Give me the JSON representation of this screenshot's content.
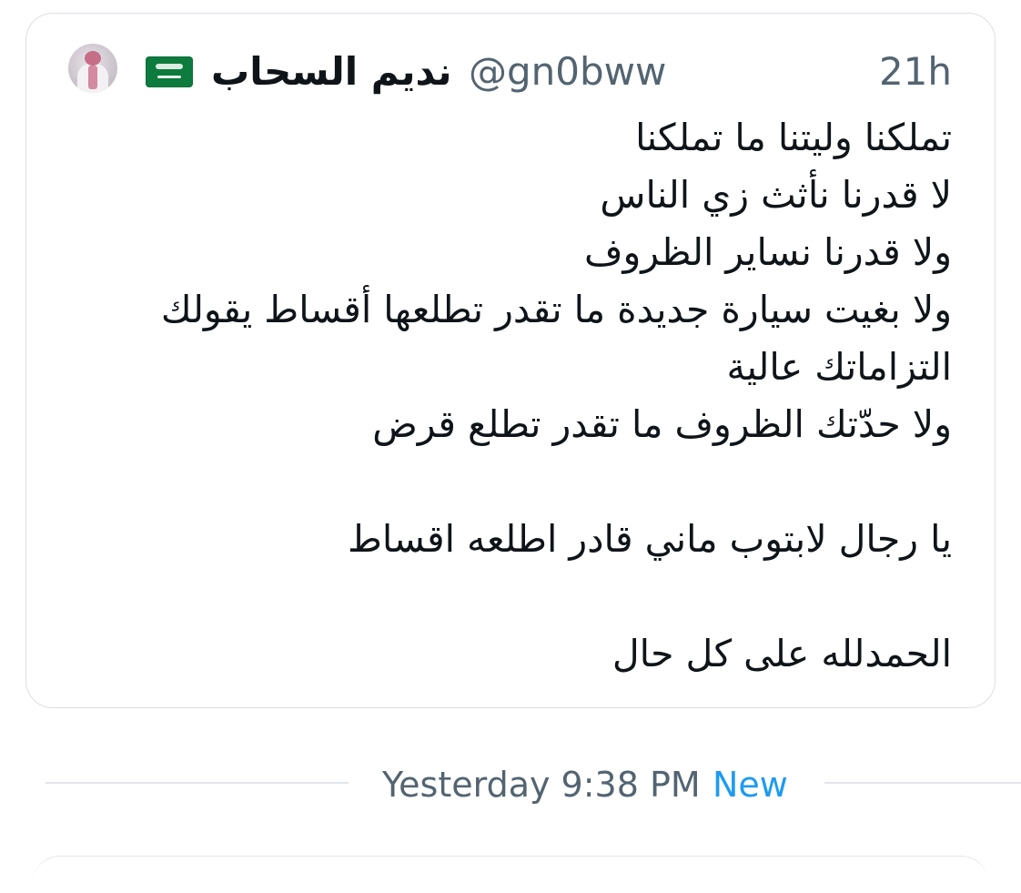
{
  "tweet": {
    "display_name": "نديم السحاب",
    "handle": "@gn0bww",
    "timestamp": "21h",
    "flag_icon": "saudi-flag-icon",
    "lines": [
      "تملكنا وليتنا ما تملكنا",
      "لا قدرنا نأثث زي الناس",
      "ولا قدرنا نساير الظروف",
      "ولا بغيت سيارة جديدة ما تقدر تطلعها أقساط يقولك",
      "التزاماتك عالية",
      "ولا حدّتك الظروف ما تقدر تطلع قرض",
      "",
      "يا رجال لابتوب ماني قادر اطلعه اقساط",
      "",
      "الحمدلله على كل حال"
    ]
  },
  "separator": {
    "label": "Yesterday 9:38 PM",
    "badge": "New",
    "badge_color": "#1d9bf0"
  }
}
